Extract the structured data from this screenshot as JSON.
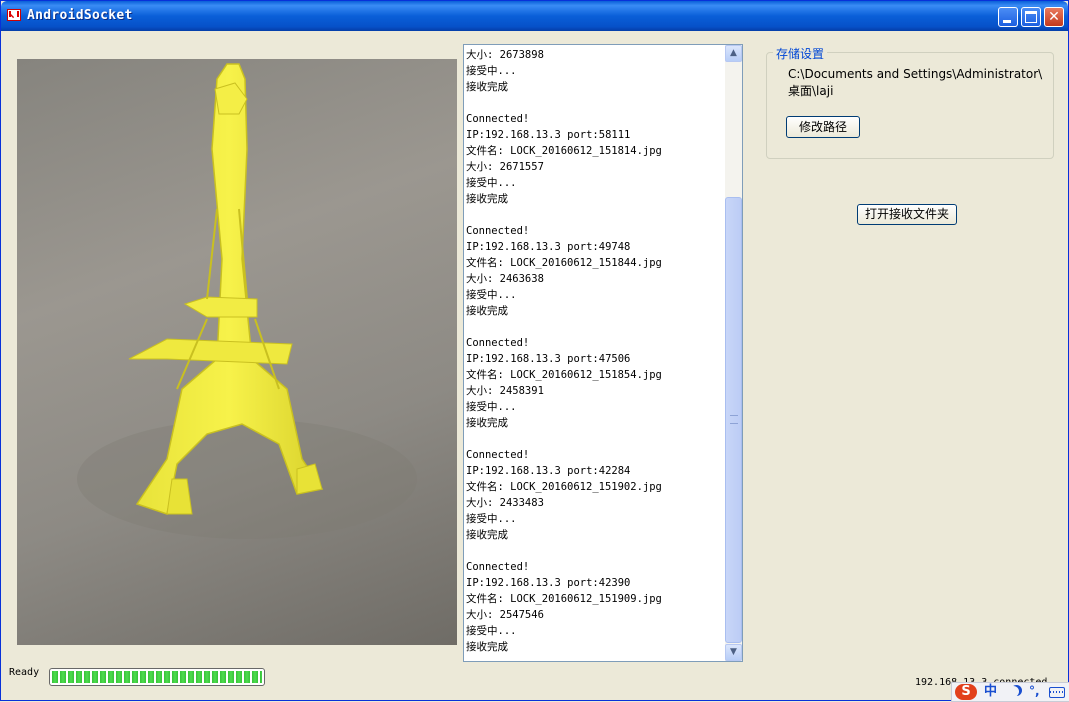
{
  "window": {
    "title": "AndroidSocket"
  },
  "log": {
    "lines": [
      "大小: 2673898",
      "接受中...",
      "接收完成",
      "",
      "Connected!",
      "IP:192.168.13.3 port:58111",
      "文件名: LOCK_20160612_151814.jpg",
      "大小: 2671557",
      "接受中...",
      "接收完成",
      "",
      "Connected!",
      "IP:192.168.13.3 port:49748",
      "文件名: LOCK_20160612_151844.jpg",
      "大小: 2463638",
      "接受中...",
      "接收完成",
      "",
      "Connected!",
      "IP:192.168.13.3 port:47506",
      "文件名: LOCK_20160612_151854.jpg",
      "大小: 2458391",
      "接受中...",
      "接收完成",
      "",
      "Connected!",
      "IP:192.168.13.3 port:42284",
      "文件名: LOCK_20160612_151902.jpg",
      "大小: 2433483",
      "接受中...",
      "接收完成",
      "",
      "Connected!",
      "IP:192.168.13.3 port:42390",
      "文件名: LOCK_20160612_151909.jpg",
      "大小: 2547546",
      "接受中...",
      "接收完成"
    ]
  },
  "storage": {
    "group_label": "存储设置",
    "path_line1": "C:\\Documents and Settings\\Administrator\\",
    "path_line2": "桌面\\laji",
    "modify_button": "修改路径"
  },
  "open_folder_button": "打开接收文件夹",
  "status": {
    "ready": "Ready",
    "progress": 1.0,
    "connection": "192.168.13.3 connected"
  },
  "ime": {
    "logo": "S",
    "mode": "中",
    "punct": "°,"
  },
  "colors": {
    "title_bar": "#0a5fd8",
    "window_bg": "#ece9d8",
    "progress_green": "#37c238",
    "group_label": "#0046d5",
    "close_button": "#c4391c"
  },
  "icons": {
    "app": "gmail-envelope-icon",
    "minimize": "minimize-icon",
    "maximize": "maximize-icon",
    "close": "close-icon"
  }
}
